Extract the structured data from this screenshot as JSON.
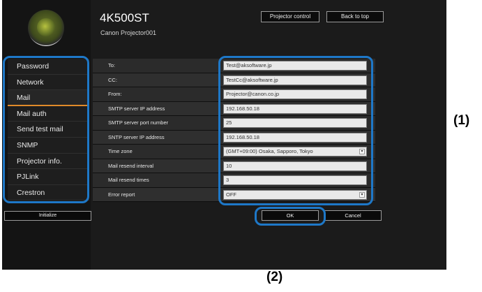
{
  "header": {
    "title": "4K500ST",
    "subtitle": "Canon Projector001",
    "projector_control_label": "Projector control",
    "back_to_top_label": "Back to top"
  },
  "sidebar": {
    "items": [
      {
        "label": "Password"
      },
      {
        "label": "Network"
      },
      {
        "label": "Mail",
        "active": true
      },
      {
        "label": "Mail auth"
      },
      {
        "label": "Send test mail"
      },
      {
        "label": "SNMP"
      },
      {
        "label": "Projector info."
      },
      {
        "label": "PJLink"
      },
      {
        "label": "Crestron"
      }
    ],
    "initialize_label": "Initialize"
  },
  "form": {
    "rows": [
      {
        "label": "To:",
        "value": "Test@aksoftware.jp",
        "type": "text"
      },
      {
        "label": "CC:",
        "value": "TestCc@aksoftware.jp",
        "type": "text"
      },
      {
        "label": "From:",
        "value": "Projector@canon.co.jp",
        "type": "text"
      },
      {
        "label": "SMTP server IP address",
        "value": "192.168.50.18",
        "type": "text"
      },
      {
        "label": "SMTP server port number",
        "value": "25",
        "type": "text"
      },
      {
        "label": "SNTP server IP address",
        "value": "192.168.50.18",
        "type": "text"
      },
      {
        "label": "Time zone",
        "value": "(GMT+09:00) Osaka, Sapporo, Tokyo",
        "type": "select"
      },
      {
        "label": "Mail resend interval",
        "value": "10",
        "type": "text"
      },
      {
        "label": "Mail resend times",
        "value": "3",
        "type": "text"
      },
      {
        "label": "Error report",
        "value": "OFF",
        "type": "select"
      }
    ],
    "ok_label": "OK",
    "cancel_label": "Cancel"
  },
  "callouts": {
    "one": "(1)",
    "two": "(2)"
  },
  "colors": {
    "highlight": "#1e78c8",
    "active_underline": "#e08a2a",
    "background": "#1b1b1b"
  },
  "icons": {
    "logo": "canon-lens-logo",
    "select_arrow": "chevron-down-icon"
  }
}
